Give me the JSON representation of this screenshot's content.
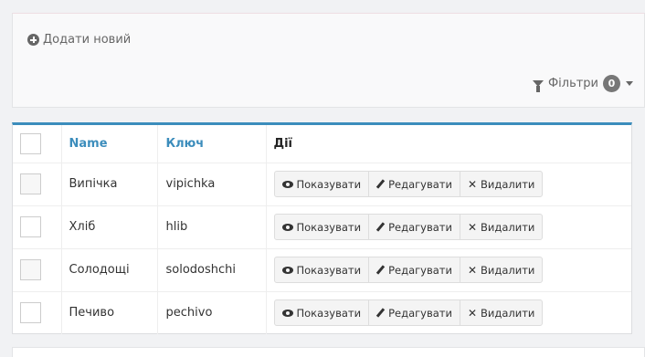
{
  "toolbar": {
    "add_new_label": "Додати новий",
    "filters_label": "Фільтри",
    "filters_count": "0"
  },
  "table": {
    "headers": {
      "name": "Name",
      "key": "Ключ",
      "actions": "Дії"
    },
    "rows": [
      {
        "name": "Випічка",
        "key": "vipichka"
      },
      {
        "name": "Хліб",
        "key": "hlib"
      },
      {
        "name": "Солодощі",
        "key": "solodoshchi"
      },
      {
        "name": "Печиво",
        "key": "pechivo"
      }
    ],
    "actions": {
      "show": "Показувати",
      "edit": "Редагувати",
      "delete": "Видалити"
    }
  },
  "colors": {
    "accent": "#3c8dbc",
    "badge": "#777777"
  }
}
